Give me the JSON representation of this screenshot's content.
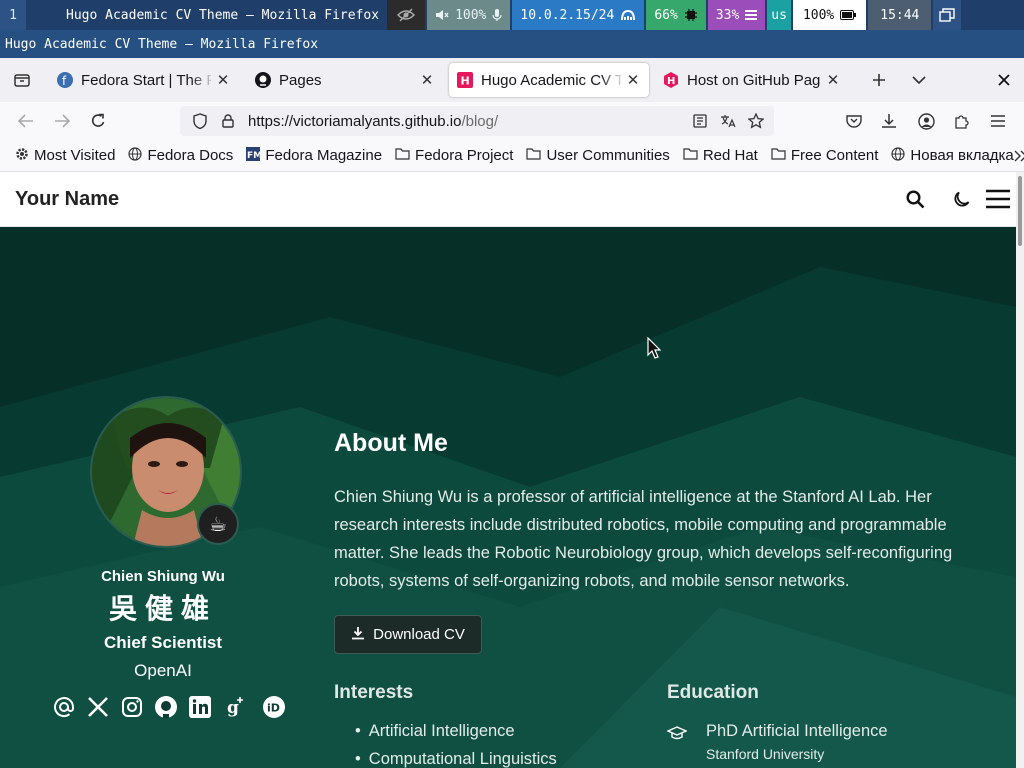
{
  "system_bar": {
    "workspace": "1",
    "window_title": "Hugo Academic CV Theme — Mozilla Firefox",
    "volume": "100%",
    "network": "10.0.2.15/24",
    "cpu": "66%",
    "memory": "33%",
    "keyboard_layout": "us",
    "battery": "100%",
    "clock": "15:44"
  },
  "window": {
    "title": "Hugo Academic CV Theme — Mozilla Firefox"
  },
  "tabs": [
    {
      "label": "Fedora Start | The Fedora Project",
      "favicon": "fedora-icon",
      "active": false
    },
    {
      "label": "Pages",
      "favicon": "github-icon",
      "active": false
    },
    {
      "label": "Hugo Academic CV Theme",
      "favicon": "hugo-icon",
      "active": true
    },
    {
      "label": "Host on GitHub Pages",
      "favicon": "hugo-icon",
      "active": false
    }
  ],
  "url": {
    "host": "https://victoriamalyants.github.io",
    "path": "/blog/"
  },
  "bookmarks": [
    {
      "label": "Most Visited",
      "icon": "gear-icon"
    },
    {
      "label": "Fedora Docs",
      "icon": "globe-icon"
    },
    {
      "label": "Fedora Magazine",
      "icon": "fm-icon"
    },
    {
      "label": "Fedora Project",
      "icon": "folder-icon"
    },
    {
      "label": "User Communities",
      "icon": "folder-icon"
    },
    {
      "label": "Red Hat",
      "icon": "folder-icon"
    },
    {
      "label": "Free Content",
      "icon": "folder-icon"
    },
    {
      "label": "Новая вкладка",
      "icon": "globe-icon"
    }
  ],
  "site": {
    "brand": "Your Name",
    "profile": {
      "name": "Chien Shiung Wu",
      "name_cjk": "吳健雄",
      "role": "Chief Scientist",
      "org": "OpenAI",
      "status_emoji": "☕"
    },
    "about": {
      "heading": "About Me",
      "bio": "Chien Shiung Wu is a professor of artificial intelligence at the Stanford AI Lab. Her research interests include distributed robotics, mobile computing and programmable matter. She leads the Robotic Neurobiology group, which develops self-reconfiguring robots, systems of self-organizing robots, and mobile sensor networks.",
      "download_cv": "Download CV"
    },
    "interests": {
      "heading": "Interests",
      "items": [
        "Artificial Intelligence",
        "Computational Linguistics"
      ]
    },
    "education": {
      "heading": "Education",
      "items": [
        {
          "degree": "PhD Artificial Intelligence",
          "school": "Stanford University"
        }
      ]
    }
  },
  "colors": {
    "hero_bg": "#083a30",
    "system_bar": "#1f3e6a"
  }
}
